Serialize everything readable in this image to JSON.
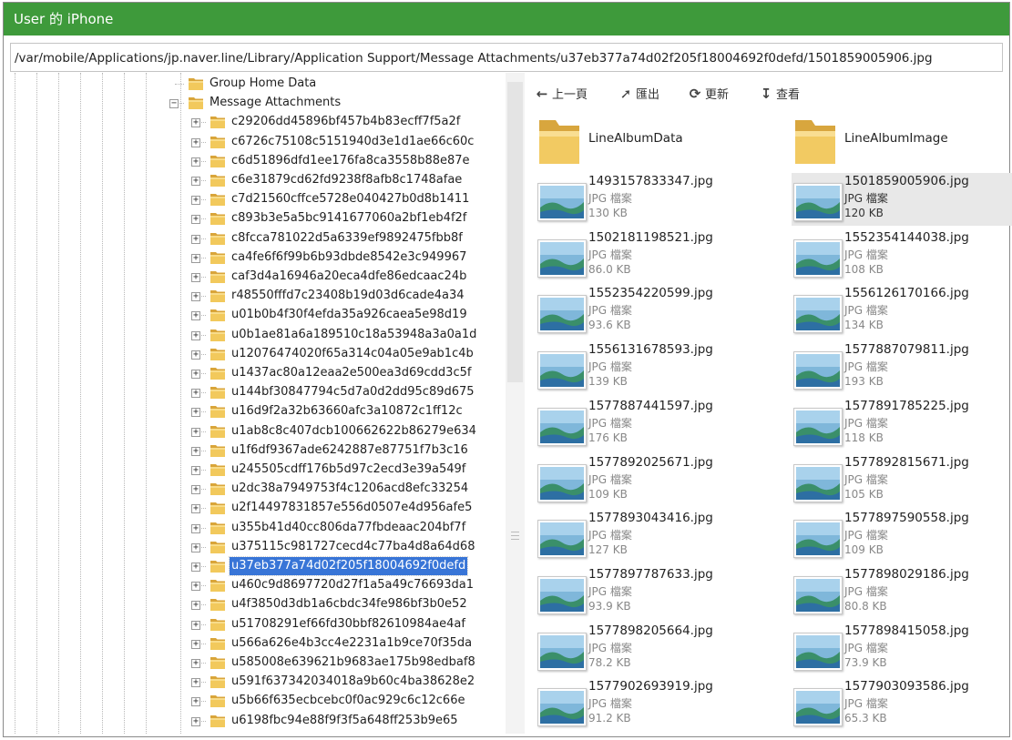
{
  "window": {
    "title": "User 的 iPhone"
  },
  "path": "/var/mobile/Applications/jp.naver.line/Library/Application Support/Message Attachments/u37eb377a74d02f205f18004692f0defd/1501859005906.jpg",
  "tree": {
    "group_home": "Group Home Data",
    "message_attachments": "Message Attachments",
    "items": [
      "c29206dd45896bf457b4b83ecff7f5a2f",
      "c6726c75108c5151940d3e1d1ae66c60c",
      "c6d51896dfd1ee176fa8ca3558b88e87e",
      "c6e31879cd62fd9238f8afb8c1748afae",
      "c7d21560cffce5728e040427b0d8b1411",
      "c893b3e5a5bc9141677060a2bf1eb4f2f",
      "c8fcca781022d5a6339ef9892475fbb8f",
      "ca4fe6f6f99b6b93dbde8542e3c949967",
      "caf3d4a16946a20eca4dfe86edcaac24b",
      "r48550fffd7c23408b19d03d6cade4a34",
      "u01b0b4f30f4efda35a926caea5e98d19",
      "u0b1ae81a6a189510c18a53948a3a0a1d",
      "u12076474020f65a314c04a05e9ab1c4b",
      "u1437ac80a12eaa2e500ea3d69cdd3c5f",
      "u144bf30847794c5d7a0d2dd95c89d675",
      "u16d9f2a32b63660afc3a10872c1ff12c",
      "u1ab8c8c407dcb100662622b86279e634",
      "u1f6df9367ade6242887e87751f7b3c16",
      "u245505cdff176b5d97c2ecd3e39a549f",
      "u2dc38a7949753f4c1206acd8efc33254",
      "u2f14497831857e556d0507e4d956afe5",
      "u355b41d40cc806da77fbdeaac204bf7f",
      "u375115c981727cecd4c77ba4d8a64d68",
      "u37eb377a74d02f205f18004692f0defd",
      "u460c9d8697720d27f1a5a49c76693da1",
      "u4f3850d3db1a6cbdc34fe986bf3b0e52",
      "u51708291ef66fd30bbf82610984ae4af",
      "u566a626e4b3cc4e2231a1b9ce70f35da",
      "u585008e639621b9683ae175b98edbaf8",
      "u591f637342034018a9b60c4ba38628e2",
      "u5b66f635ecbcebc0f0ac929c6c12c66e",
      "u6198fbc94e88f9f3f5a648ff253b9e65"
    ]
  },
  "toolbar": {
    "back": "上一頁",
    "export": "匯出",
    "refresh": "更新",
    "view": "查看"
  },
  "files": {
    "folders": [
      "LineAlbumData",
      "LineAlbumImage"
    ],
    "items": [
      {
        "name": "1493157833347.jpg",
        "type": "JPG 檔案",
        "size": "130 KB"
      },
      {
        "name": "1501859005906.jpg",
        "type": "JPG 檔案",
        "size": "120 KB"
      },
      {
        "name": "1502181198521.jpg",
        "type": "JPG 檔案",
        "size": "86.0 KB"
      },
      {
        "name": "1552354144038.jpg",
        "type": "JPG 檔案",
        "size": "108 KB"
      },
      {
        "name": "1552354220599.jpg",
        "type": "JPG 檔案",
        "size": "93.6 KB"
      },
      {
        "name": "1556126170166.jpg",
        "type": "JPG 檔案",
        "size": "134 KB"
      },
      {
        "name": "1556131678593.jpg",
        "type": "JPG 檔案",
        "size": "139 KB"
      },
      {
        "name": "1577887079811.jpg",
        "type": "JPG 檔案",
        "size": "193 KB"
      },
      {
        "name": "1577887441597.jpg",
        "type": "JPG 檔案",
        "size": "176 KB"
      },
      {
        "name": "1577891785225.jpg",
        "type": "JPG 檔案",
        "size": "118 KB"
      },
      {
        "name": "1577892025671.jpg",
        "type": "JPG 檔案",
        "size": "109 KB"
      },
      {
        "name": "1577892815671.jpg",
        "type": "JPG 檔案",
        "size": "105 KB"
      },
      {
        "name": "1577893043416.jpg",
        "type": "JPG 檔案",
        "size": "127 KB"
      },
      {
        "name": "1577897590558.jpg",
        "type": "JPG 檔案",
        "size": "109 KB"
      },
      {
        "name": "1577897787633.jpg",
        "type": "JPG 檔案",
        "size": "93.9 KB"
      },
      {
        "name": "1577898029186.jpg",
        "type": "JPG 檔案",
        "size": "80.8 KB"
      },
      {
        "name": "1577898205664.jpg",
        "type": "JPG 檔案",
        "size": "78.2 KB"
      },
      {
        "name": "1577898415058.jpg",
        "type": "JPG 檔案",
        "size": "73.9 KB"
      },
      {
        "name": "1577902693919.jpg",
        "type": "JPG 檔案",
        "size": "91.2 KB"
      },
      {
        "name": "1577903093586.jpg",
        "type": "JPG 檔案",
        "size": "65.3 KB"
      }
    ]
  },
  "colors": {
    "titlebar": "#3e9a3b",
    "selection": "#3875d7",
    "folder": "#e8b94a"
  }
}
